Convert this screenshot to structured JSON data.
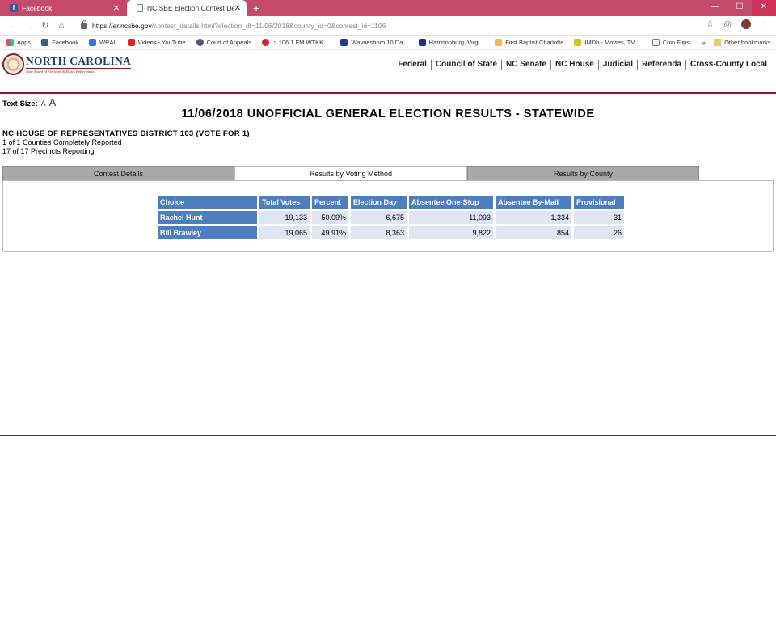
{
  "browser": {
    "tabs": [
      {
        "title": "Facebook",
        "close": "✕"
      },
      {
        "title": "NC SBE Election Contest Details",
        "close": "✕"
      }
    ],
    "new_tab": "+",
    "window": {
      "minimize": "—",
      "maximize": "☐",
      "close": "✕"
    },
    "url_host": "https://er.ncsbe.gov",
    "url_path": "/contest_details.html?election_dt=11/06/2018&county_id=0&contest_id=1106",
    "bookmarks": [
      {
        "label": "Apps",
        "icon": "apps-icon"
      },
      {
        "label": "Facebook",
        "icon": "facebook-icon"
      },
      {
        "label": "WRAL",
        "icon": "wral-icon"
      },
      {
        "label": "Videos - YouTube",
        "icon": "youtube-icon"
      },
      {
        "label": "Court of Appeals",
        "icon": "court-icon"
      },
      {
        "label": "♫ 106.1 FM WTKK ...",
        "icon": "iheart-icon"
      },
      {
        "label": "Waynesboro 10 Da...",
        "icon": "weather-icon"
      },
      {
        "label": "Harrisonburg, Virgi...",
        "icon": "channel3-icon"
      },
      {
        "label": "First Baptist Charlotte",
        "icon": "church-icon"
      },
      {
        "label": "IMDb - Movies, TV ...",
        "icon": "imdb-icon"
      },
      {
        "label": "Coin Flips",
        "icon": "page-icon"
      }
    ],
    "bookmarks_more": "»",
    "other_bookmarks": "Other bookmarks"
  },
  "site": {
    "logo_name": "NORTH CAROLINA",
    "logo_sub": "State Board of Elections & Ethics Enforcement",
    "nav": [
      "Federal",
      "Council of State",
      "NC Senate",
      "NC House",
      "Judicial",
      "Referenda",
      "Cross-County Local"
    ]
  },
  "text_size": {
    "label": "Text Size:",
    "small": "A",
    "large": "A"
  },
  "page_title": "11/06/2018 UNOFFICIAL GENERAL ELECTION RESULTS - STATEWIDE",
  "contest": {
    "name": "NC HOUSE OF REPRESENTATIVES DISTRICT 103 (VOTE FOR 1)",
    "counties": "1 of 1 Counties Completely Reported",
    "precincts": "17 of 17 Precincts Reporting"
  },
  "tabs": [
    "Contest Details",
    "Results by Voting Method",
    "Results by County"
  ],
  "results": {
    "headers": [
      "Choice",
      "Total Votes",
      "Percent",
      "Election Day",
      "Absentee One-Stop",
      "Absentee By-Mail",
      "Provisional"
    ],
    "rows": [
      {
        "choice": "Rachel Hunt",
        "total": "19,133",
        "percent": "50.09%",
        "election_day": "6,675",
        "one_stop": "11,093",
        "by_mail": "1,334",
        "provisional": "31"
      },
      {
        "choice": "Bill Brawley",
        "total": "19,065",
        "percent": "49.91%",
        "election_day": "8,363",
        "one_stop": "9,822",
        "by_mail": "854",
        "provisional": "26"
      }
    ]
  },
  "colors": {
    "accent": "#8b1a2b",
    "header_blue": "#4d7fbf",
    "cell_blue": "#dde6f2",
    "chrome": "#c44a6b"
  }
}
